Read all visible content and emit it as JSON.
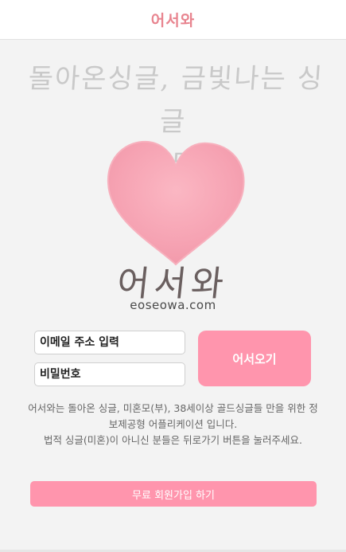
{
  "header": {
    "title": "어서와"
  },
  "hero": {
    "tagline_line1": "돌아온싱글, 금빛나는 싱글",
    "tagline_line2": "모두",
    "wordmark": "어서와",
    "domain": "eoseowa.com",
    "heart_color": "#f6a3b3"
  },
  "login": {
    "email_placeholder": "이메일 주소 입력",
    "password_placeholder": "비밀번호",
    "submit_label": "어서오기"
  },
  "notice": {
    "line1": "어서와는 돌아온 싱글, 미혼모(부), 38세이상 골드싱글들 만을 위한 정보제공형 어플리케이션 입니다.",
    "line2": "법적 싱글(미혼)이 아니신 분들은 뒤로가기 버튼을 눌러주세요."
  },
  "signup": {
    "label": "무료 회원가입 하기"
  },
  "colors": {
    "accent": "#ff95ad",
    "header_text": "#e8848f"
  }
}
